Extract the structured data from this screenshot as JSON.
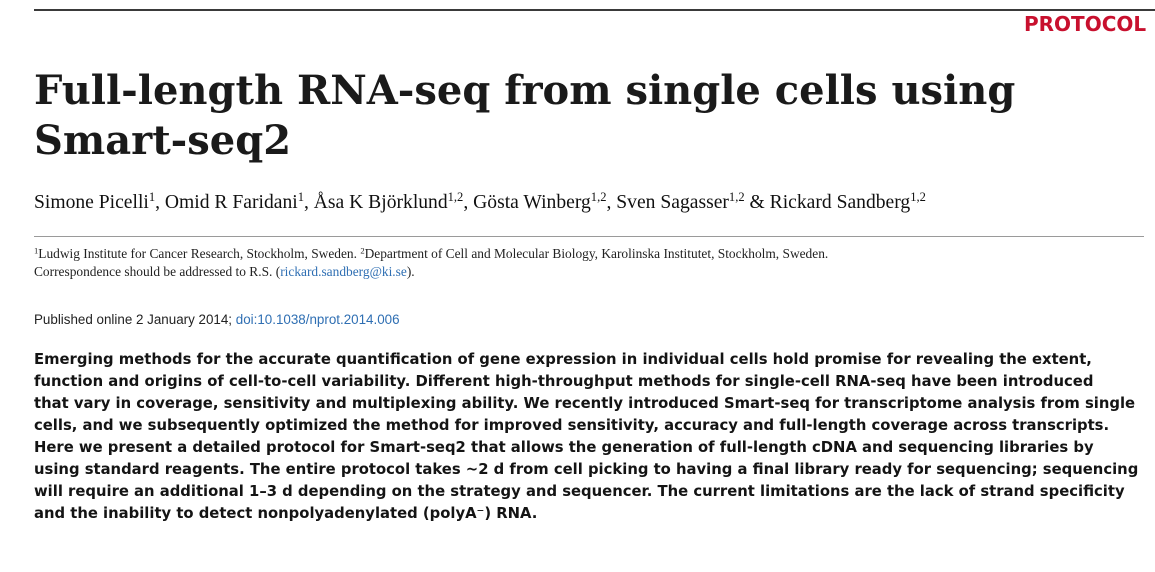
{
  "header": {
    "section_label": "PROTOCOL"
  },
  "article": {
    "title_line1": "Full-length RNA-seq from single cells using",
    "title_line2": "Smart-seq2",
    "authors": [
      {
        "name": "Simone Picelli",
        "affil": "1"
      },
      {
        "name": "Omid R Faridani",
        "affil": "1"
      },
      {
        "name": "Åsa K Björklund",
        "affil": "1,2"
      },
      {
        "name": "Gösta Winberg",
        "affil": "1,2"
      },
      {
        "name": "Sven Sagasser",
        "affil": "1,2"
      },
      {
        "name": "Rickard Sandberg",
        "affil": "1,2"
      }
    ],
    "author_separator": ", ",
    "author_last_separator": " & ",
    "affiliations": {
      "mark1": "1",
      "text1": "Ludwig Institute for Cancer Research, Stockholm, Sweden. ",
      "mark2": "2",
      "text2": "Department of Cell and Molecular Biology, Karolinska Institutet, Stockholm, Sweden.",
      "correspondence_prefix": "Correspondence should be addressed to R.S. (",
      "email": "rickard.sandberg@ki.se",
      "correspondence_suffix": ")."
    },
    "published": {
      "label": "Published online 2 January 2014; ",
      "doi": "doi:10.1038/nprot.2014.006"
    },
    "abstract_lines": [
      "Emerging methods for the accurate quantification of gene expression in individual cells hold promise for revealing the extent,",
      "function and origins of cell-to-cell variability. Different high-throughput methods for single-cell RNA-seq have been introduced",
      "that vary in coverage, sensitivity and multiplexing ability. We recently introduced Smart-seq for transcriptome analysis from single",
      "cells, and we subsequently optimized the method for improved sensitivity, accuracy and full-length coverage across transcripts.",
      "Here we present a detailed protocol for Smart-seq2 that allows the generation of full-length cDNA and sequencing libraries by",
      "using standard reagents. The entire protocol takes ~2 d from cell picking to having a final library ready for sequencing; sequencing",
      "will require an additional 1–3 d depending on the strategy and sequencer. The current limitations are the lack of strand specificity",
      "and the inability to detect nonpolyadenylated (polyA⁻) RNA."
    ]
  },
  "colors": {
    "accent": "#c8102e",
    "link": "#2f6fb3",
    "text": "#111111"
  }
}
